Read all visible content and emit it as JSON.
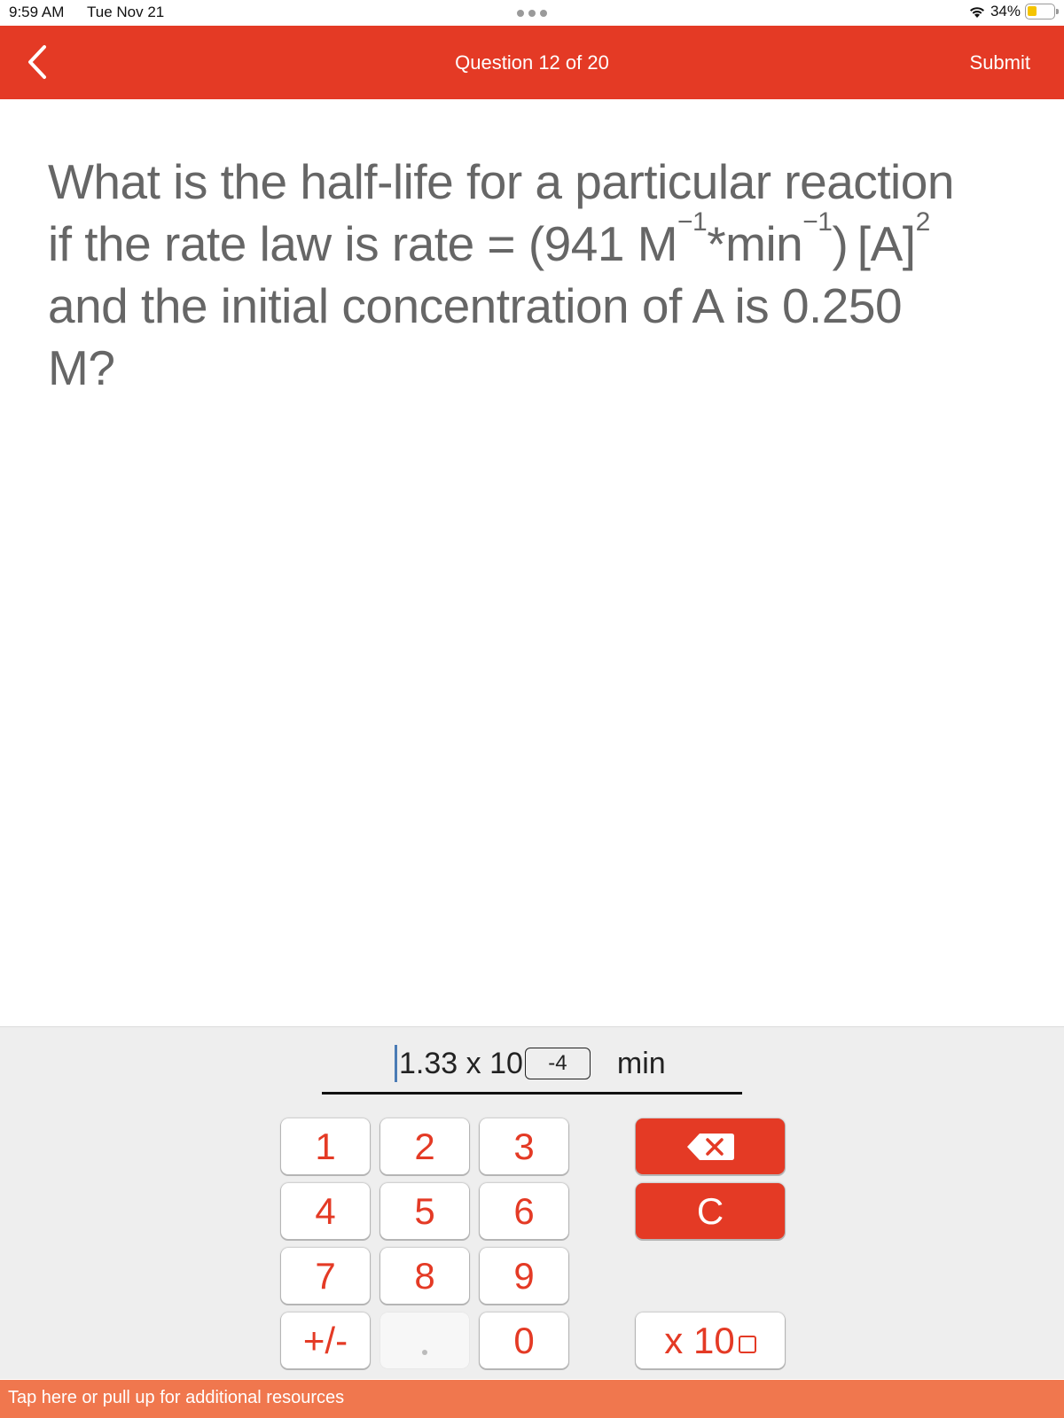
{
  "status_bar": {
    "time": "9:59 AM",
    "date": "Tue Nov 21",
    "battery_percent_label": "34%",
    "battery_level": 0.34,
    "icons": [
      "wifi-icon",
      "battery-icon"
    ]
  },
  "nav": {
    "back_icon": "chevron-left-icon",
    "title": "Question 12 of 20",
    "submit_label": "Submit"
  },
  "question": {
    "line1": "What is the half-life for a particular reaction",
    "line2_prefix": "if the rate law is rate = (941 M",
    "exp1": "−1",
    "mid": "*min",
    "exp2": "−1",
    "suffix": ") [A]",
    "exp3": "2",
    "line3": "and the initial concentration of A is 0.250",
    "line4": "M?"
  },
  "answer": {
    "mantissa": "1.33 x 10",
    "exponent": "-4",
    "unit": "min"
  },
  "keypad": {
    "keys": [
      "1",
      "2",
      "3",
      "4",
      "5",
      "6",
      "7",
      "8",
      "9",
      "+/-",
      ".",
      "0"
    ],
    "backspace_icon": "backspace-icon",
    "clear_label": "C",
    "x10_label": "x 10"
  },
  "colors": {
    "brand_red": "#e43a25",
    "resources_orange": "#f0774e",
    "question_gray": "#666666"
  },
  "resources_bar": {
    "label": "Tap here or pull up for additional resources"
  }
}
